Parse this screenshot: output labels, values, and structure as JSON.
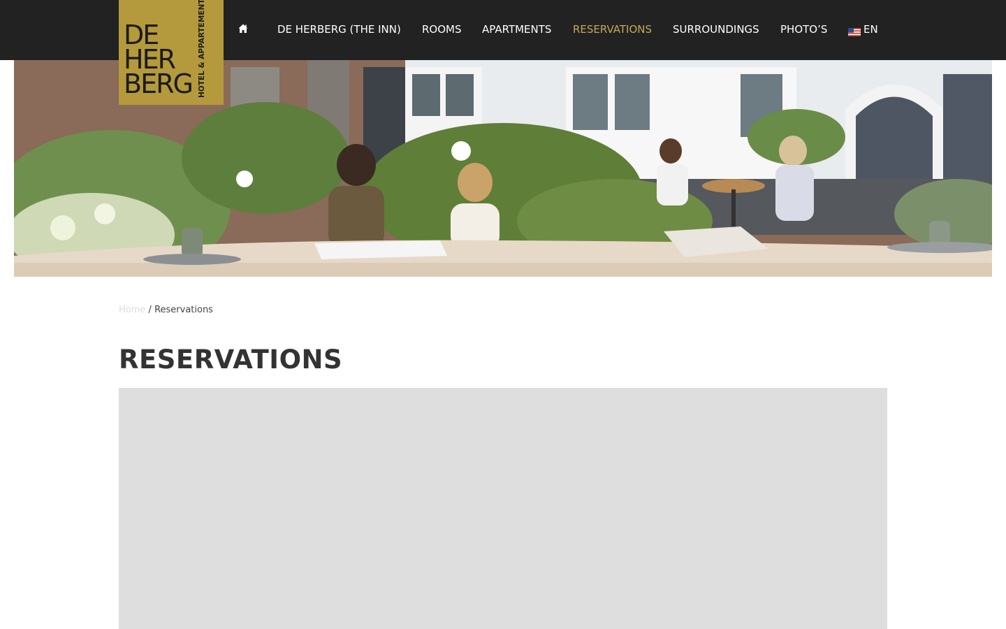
{
  "brand": {
    "logo_line1": "DE",
    "logo_line2": "HER",
    "logo_line3": "BERG",
    "logo_sub": "HOTEL & APPARTEMENTEN",
    "logo_color": "#b49a3c"
  },
  "nav": {
    "home_icon": "home-icon",
    "items": [
      {
        "label": "DE HERBERG (THE INN)",
        "active": false
      },
      {
        "label": "ROOMS",
        "active": false
      },
      {
        "label": "APARTMENTS",
        "active": false
      },
      {
        "label": "RESERVATIONS",
        "active": true
      },
      {
        "label": "SURROUNDINGS",
        "active": false
      },
      {
        "label": "PHOTO’S",
        "active": false
      }
    ],
    "language": "EN",
    "language_flag": "us-flag-icon",
    "active_color": "#c4a85a",
    "bar_color": "#222222"
  },
  "breadcrumb": {
    "home": "Home",
    "separator": "/",
    "current": "Reservations"
  },
  "page": {
    "title": "RESERVATIONS"
  }
}
